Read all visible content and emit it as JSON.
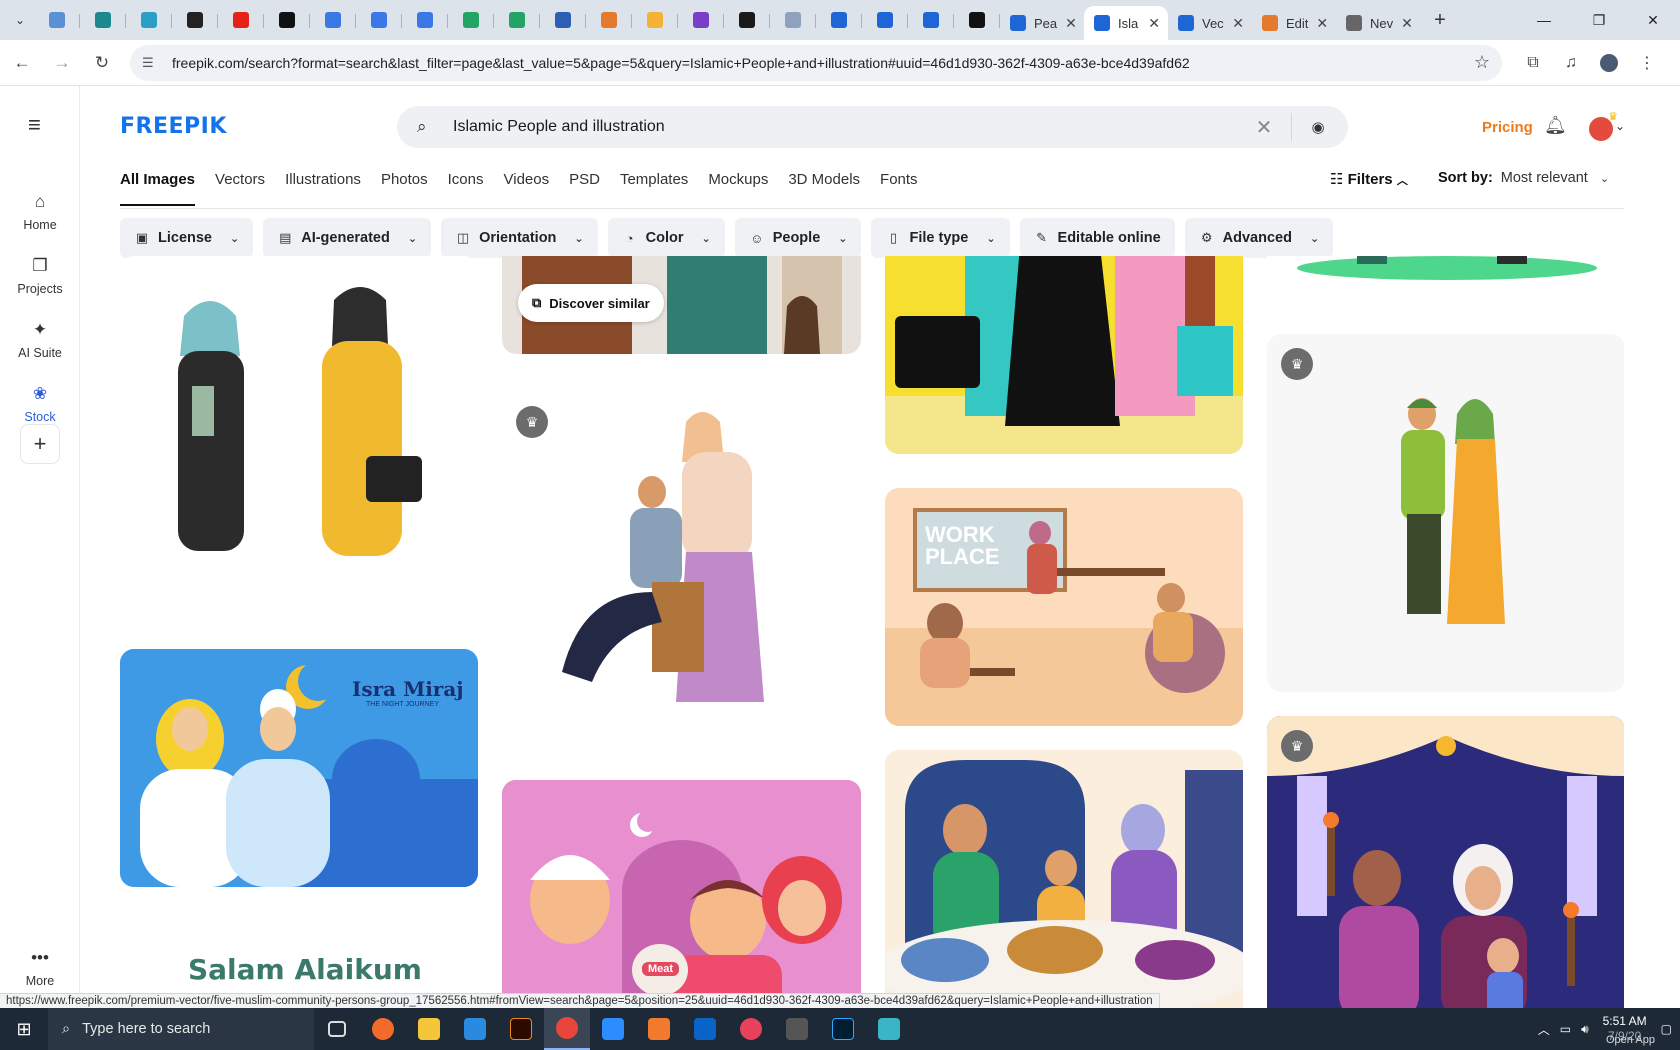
{
  "browser": {
    "tabs_compact": [
      {
        "icon": "edge-blue-icon",
        "color": "#5b8fd6"
      },
      {
        "icon": "vpn-shield-icon",
        "color": "#1c8a8c"
      },
      {
        "icon": "hexagon-app-icon",
        "color": "#2aa0c6"
      },
      {
        "icon": "chatgpt-icon",
        "color": "#222222"
      },
      {
        "icon": "youtube-icon",
        "color": "#e62117"
      },
      {
        "icon": "bolt-app-icon",
        "color": "#111111"
      },
      {
        "icon": "google-docs-icon",
        "color": "#3a78e6"
      },
      {
        "icon": "google-docs-icon",
        "color": "#3a78e6"
      },
      {
        "icon": "google-docs-icon",
        "color": "#3a78e6"
      },
      {
        "icon": "google-sheets-icon",
        "color": "#21a464"
      },
      {
        "icon": "google-sheets-icon",
        "color": "#21a464"
      },
      {
        "icon": "word-doc-icon",
        "color": "#2b5fb3"
      },
      {
        "icon": "orange-grid-icon",
        "color": "#e47a2e"
      },
      {
        "icon": "yellow-star-icon",
        "color": "#f2b233"
      },
      {
        "icon": "curly-braces-icon",
        "color": "#7a3fc8"
      },
      {
        "icon": "black-a-icon",
        "color": "#1a1a1a"
      },
      {
        "icon": "gray-grid-icon",
        "color": "#8ea2c0"
      },
      {
        "icon": "blue-form-icon",
        "color": "#1e66d6"
      },
      {
        "icon": "blue-form-icon",
        "color": "#1e66d6"
      },
      {
        "icon": "blue-form-icon",
        "color": "#1e66d6"
      },
      {
        "icon": "medium-m-icon",
        "color": "#111111"
      }
    ],
    "tabs_full": [
      {
        "label": "Pea",
        "icon": "blue-form-icon",
        "color": "#1e66d6",
        "active": false
      },
      {
        "label": "Isla",
        "icon": "blue-form-icon",
        "color": "#1e66d6",
        "active": true
      },
      {
        "label": "Vec",
        "icon": "blue-form-icon",
        "color": "#1e66d6",
        "active": false
      },
      {
        "label": "Edit",
        "icon": "orange-grid-icon",
        "color": "#e47a2e",
        "active": false
      },
      {
        "label": "Nev",
        "icon": "globe-icon",
        "color": "#666666",
        "active": false
      }
    ],
    "url": "freepik.com/search?format=search&last_filter=page&last_value=5&page=5&query=Islamic+People+and+illustration#uuid=46d1d930-362f-4309-a63e-bce4d39afd62",
    "status_url": "https://www.freepik.com/premium-vector/five-muslim-community-persons-group_17562556.htm#fromView=search&page=5&position=25&uuid=46d1d930-362f-4309-a63e-bce4d39afd62&query=Islamic+People+and+illustration"
  },
  "rail": {
    "items": [
      {
        "label": "Home",
        "icon": "home-icon"
      },
      {
        "label": "Projects",
        "icon": "projects-icon"
      },
      {
        "label": "AI Suite",
        "icon": "ai-sparkle-icon"
      },
      {
        "label": "Stock",
        "icon": "stock-icon"
      }
    ],
    "more_label": "More"
  },
  "header": {
    "logo": "FREEPIK",
    "search_value": "Islamic People and illustration",
    "pricing": "Pricing"
  },
  "categories": [
    "All Images",
    "Vectors",
    "Illustrations",
    "Photos",
    "Icons",
    "Videos",
    "PSD",
    "Templates",
    "Mockups",
    "3D Models",
    "Fonts"
  ],
  "toolbar": {
    "filters": "Filters",
    "sort_label": "Sort by:",
    "sort_value": "Most relevant"
  },
  "chips": [
    {
      "label": "License",
      "icon": "license-icon"
    },
    {
      "label": "AI-generated",
      "icon": "ai-generated-icon"
    },
    {
      "label": "Orientation",
      "icon": "orientation-icon"
    },
    {
      "label": "Color",
      "icon": "palette-icon"
    },
    {
      "label": "People",
      "icon": "people-icon"
    },
    {
      "label": "File type",
      "icon": "file-icon"
    },
    {
      "label": "Editable online",
      "icon": "pencil-icon",
      "no_chevron": true
    },
    {
      "label": "Advanced",
      "icon": "gear-icon"
    }
  ],
  "results": {
    "discover_similar": "Discover similar",
    "card_texts": {
      "isra_miraj": "Isra Miraj",
      "isra_sub": "THE NIGHT JOURNEY",
      "salam": "Salam Alaikum",
      "work_place": "WORK PLACE",
      "meat": "Meat"
    }
  },
  "taskbar": {
    "search_placeholder": "Type here to search",
    "time": "5:51 AM",
    "date": "7/9/20",
    "open_app": "Open App"
  }
}
